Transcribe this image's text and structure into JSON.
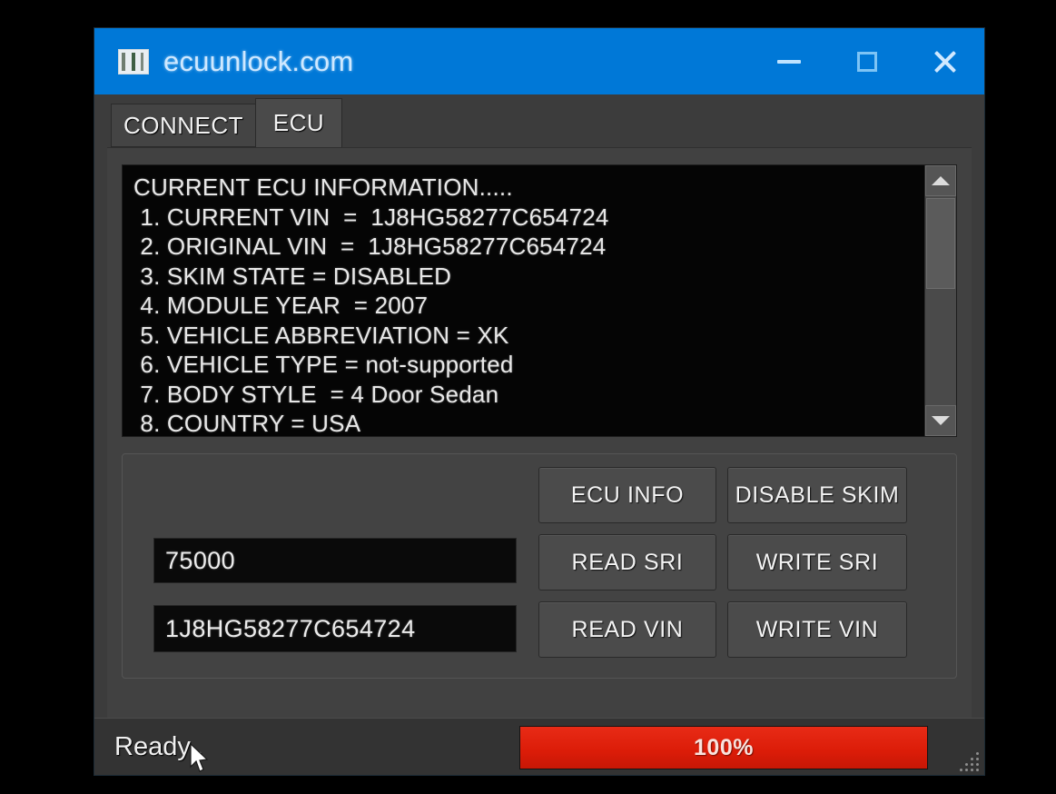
{
  "window": {
    "title": "ecuunlock.com",
    "icon": "app-window-icon",
    "controls": {
      "minimize": "minimize-icon",
      "maximize": "maximize-icon",
      "close": "close-icon"
    }
  },
  "tabs": [
    {
      "label": "CONNECT",
      "active": false
    },
    {
      "label": "ECU",
      "active": true
    }
  ],
  "console": {
    "lines": [
      "CURRENT ECU INFORMATION.....",
      " 1. CURRENT VIN  =  1J8HG58277C654724",
      " 2. ORIGINAL VIN  =  1J8HG58277C654724",
      " 3. SKIM STATE = DISABLED",
      " 4. MODULE YEAR  = 2007",
      " 5. VEHICLE ABBREVIATION = XK",
      " 6. VEHICLE TYPE = not-supported",
      " 7. BODY STYLE  = 4 Door Sedan",
      " 8. COUNTRY = USA"
    ],
    "scrollbar": {
      "up_arrow": "scroll-up-icon",
      "down_arrow": "scroll-down-icon"
    }
  },
  "controls": {
    "sri_value": "75000",
    "vin_value": "1J8HG58277C654724",
    "buttons": {
      "ecu_info": "ECU INFO",
      "disable_skim": "DISABLE SKIM",
      "read_sri": "READ SRI",
      "write_sri": "WRITE SRI",
      "read_vin": "READ VIN",
      "write_vin": "WRITE VIN"
    }
  },
  "statusbar": {
    "status": "Ready..",
    "progress_label": "100%",
    "progress_percent": 100,
    "progress_color": "#e0200e"
  },
  "colors": {
    "titlebar": "#0078d7",
    "window_bg": "#3c3c3c",
    "console_bg": "#050505",
    "accent_red": "#e0200e"
  }
}
